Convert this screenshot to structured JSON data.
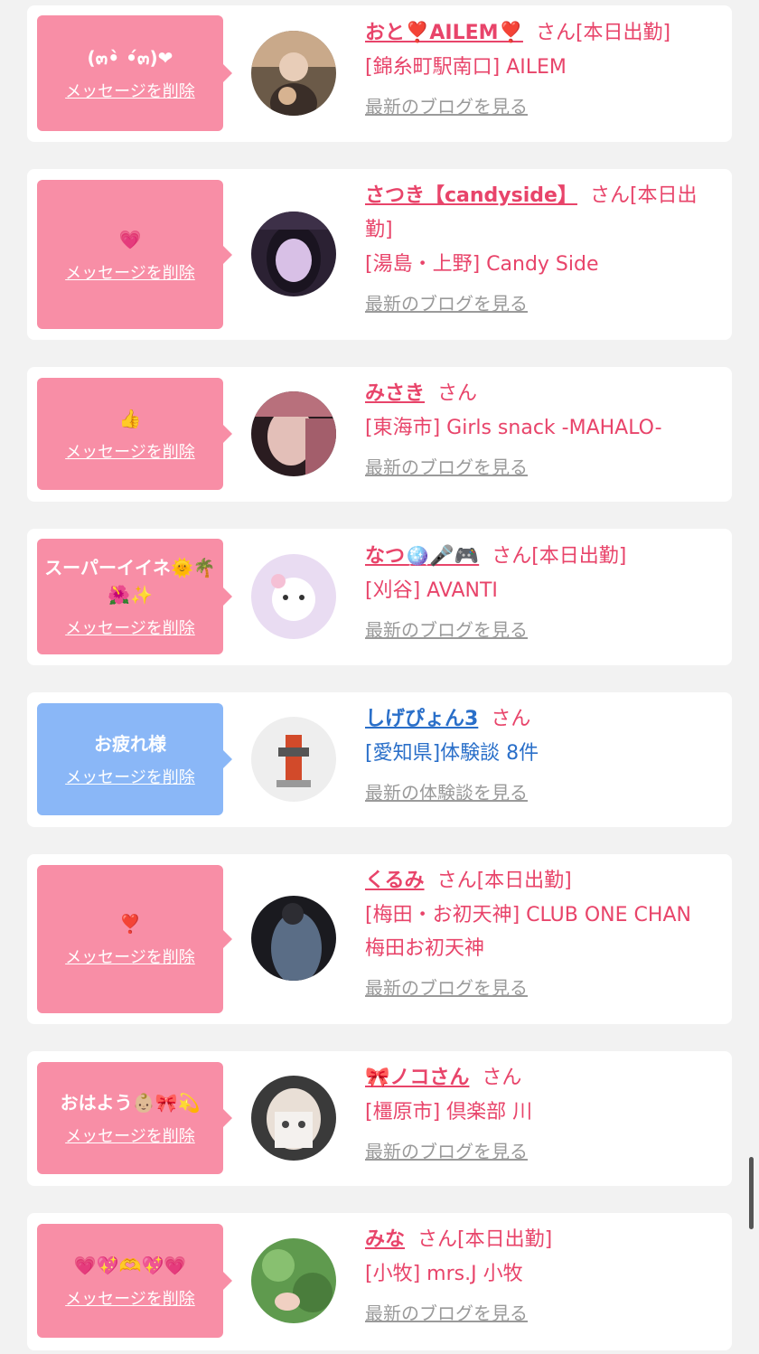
{
  "delete_label": "メッセージを削除",
  "san_label": "さん",
  "items": [
    {
      "message": "(๓•̀ •́๓)❤",
      "name": "おと❣️AILEM❣️",
      "status": "[本日出勤]",
      "shop": "[錦糸町駅南口] AILEM",
      "link": "最新のブログを見る",
      "type": "girl"
    },
    {
      "message": "💗",
      "name": "さつき【candyside】",
      "status": "[本日出勤]",
      "shop": "[湯島・上野] Candy Side",
      "link": "最新のブログを見る",
      "type": "girl"
    },
    {
      "message": "👍",
      "name": "みさき",
      "status": "",
      "shop": "[東海市] Girls snack -MAHALO-",
      "link": "最新のブログを見る",
      "type": "girl"
    },
    {
      "message": "スーパーイイネ🌞🌴🌺✨",
      "name": "なつ🪩🎤🎮",
      "status": "[本日出勤]",
      "shop": "[刈谷] AVANTI",
      "link": "最新のブログを見る",
      "type": "girl"
    },
    {
      "message": "お疲れ様",
      "name": "しげぴょん3",
      "status": "",
      "shop": "[愛知県]体験談 8件",
      "link": "最新の体験談を見る",
      "type": "user"
    },
    {
      "message": "❣️",
      "name": "くるみ",
      "status": "[本日出勤]",
      "shop": "[梅田・お初天神] CLUB ONE CHAN 梅田お初天神",
      "link": "最新のブログを見る",
      "type": "girl"
    },
    {
      "message": "おはよう👶🏼🎀💫",
      "name": "🎀ノコさん",
      "status": "",
      "shop": "[橿原市] 倶楽部 川",
      "link": "最新のブログを見る",
      "type": "girl"
    },
    {
      "message": "💗💖🫶💖💗",
      "name": "みな",
      "status": "[本日出勤]",
      "shop": "[小牧] mrs.J 小牧",
      "link": "最新のブログを見る",
      "type": "girl"
    }
  ],
  "colors": {
    "pink": "#f88ea6",
    "blue": "#8ab7f7",
    "name_pink": "#e8446a",
    "name_blue": "#2a6fc9",
    "link_gray": "#9a9a9a"
  }
}
